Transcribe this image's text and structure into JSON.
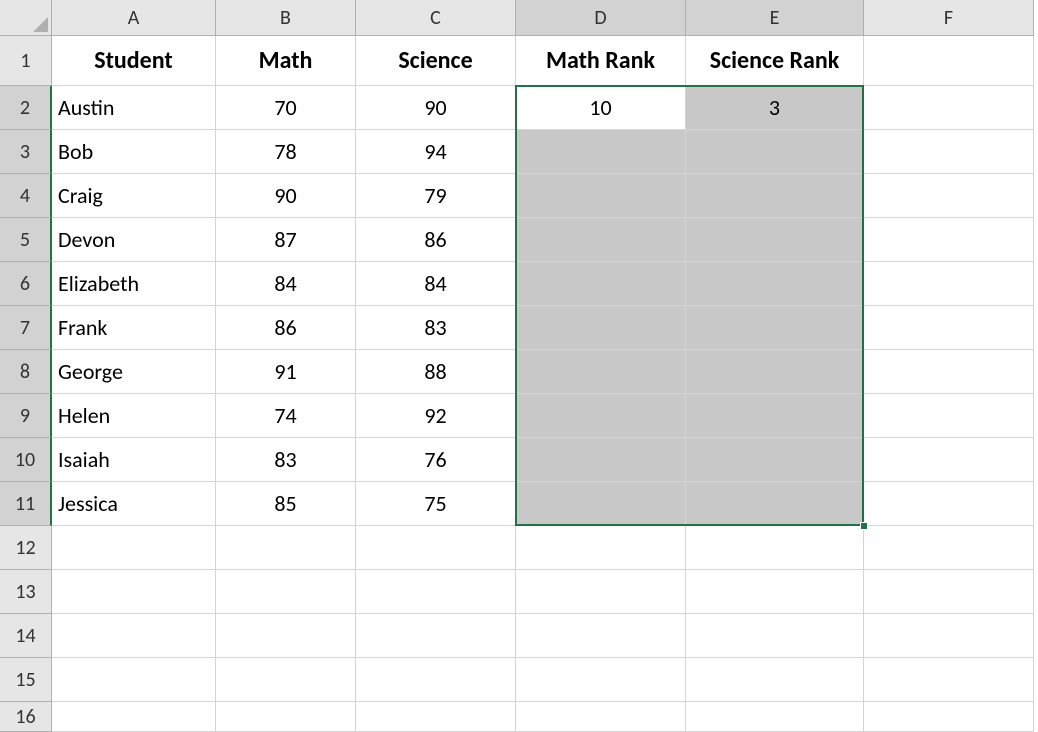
{
  "columns": [
    "A",
    "B",
    "C",
    "D",
    "E",
    "F"
  ],
  "rows": [
    "1",
    "2",
    "3",
    "4",
    "5",
    "6",
    "7",
    "8",
    "9",
    "10",
    "11",
    "12",
    "13",
    "14",
    "15",
    "16"
  ],
  "header": {
    "A": "Student",
    "B": "Math",
    "C": "Science",
    "D": "Math Rank",
    "E": "Science Rank"
  },
  "data": [
    {
      "student": "Austin",
      "math": "70",
      "science": "90",
      "mathRank": "10",
      "scienceRank": "3"
    },
    {
      "student": "Bob",
      "math": "78",
      "science": "94",
      "mathRank": "",
      "scienceRank": ""
    },
    {
      "student": "Craig",
      "math": "90",
      "science": "79",
      "mathRank": "",
      "scienceRank": ""
    },
    {
      "student": "Devon",
      "math": "87",
      "science": "86",
      "mathRank": "",
      "scienceRank": ""
    },
    {
      "student": "Elizabeth",
      "math": "84",
      "science": "84",
      "mathRank": "",
      "scienceRank": ""
    },
    {
      "student": "Frank",
      "math": "86",
      "science": "83",
      "mathRank": "",
      "scienceRank": ""
    },
    {
      "student": "George",
      "math": "91",
      "science": "88",
      "mathRank": "",
      "scienceRank": ""
    },
    {
      "student": "Helen",
      "math": "74",
      "science": "92",
      "mathRank": "",
      "scienceRank": ""
    },
    {
      "student": "Isaiah",
      "math": "83",
      "science": "76",
      "mathRank": "",
      "scienceRank": ""
    },
    {
      "student": "Jessica",
      "math": "85",
      "science": "75",
      "mathRank": "",
      "scienceRank": ""
    }
  ],
  "selection": {
    "activeCell": "D2",
    "range": "D2:E11"
  }
}
